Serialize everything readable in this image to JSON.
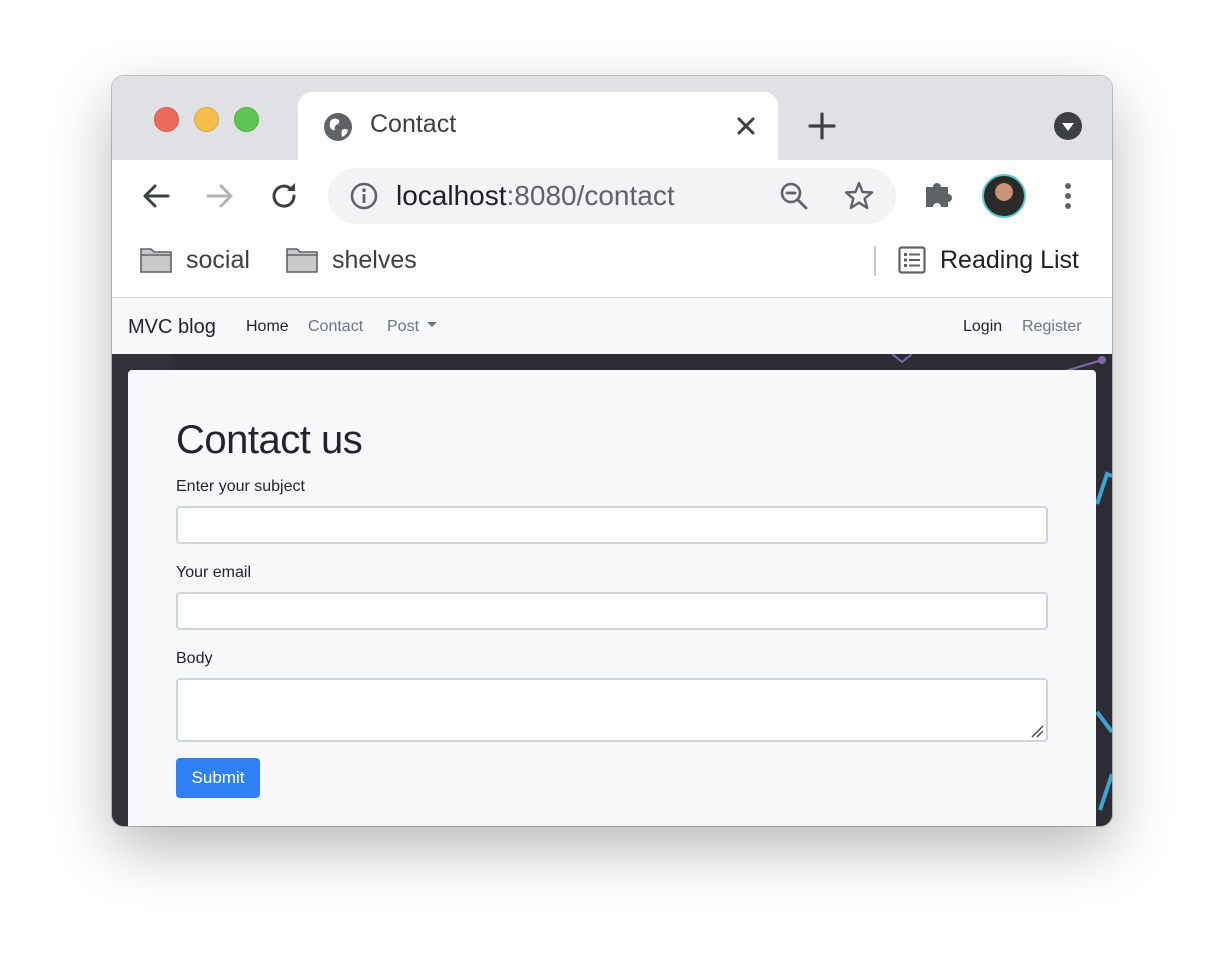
{
  "browser": {
    "tab": {
      "title": "Contact",
      "icon": "globe-icon"
    },
    "address": {
      "host": "localhost",
      "rest": ":8080/contact"
    },
    "bookmarks": [
      {
        "label": "social",
        "icon": "folder-icon"
      },
      {
        "label": "shelves",
        "icon": "folder-icon"
      }
    ],
    "reading_list": "Reading List"
  },
  "site": {
    "brand": "MVC blog",
    "nav": {
      "home": "Home",
      "contact": "Contact",
      "post": "Post"
    },
    "auth": {
      "login": "Login",
      "register": "Register"
    }
  },
  "form": {
    "title": "Contact us",
    "subject_label": "Enter your subject",
    "email_label": "Your email",
    "body_label": "Body",
    "submit": "Submit"
  },
  "colors": {
    "primary": "#2f80f5",
    "tabbar": "#dfe1e5",
    "page_bg": "#2f2e37"
  }
}
